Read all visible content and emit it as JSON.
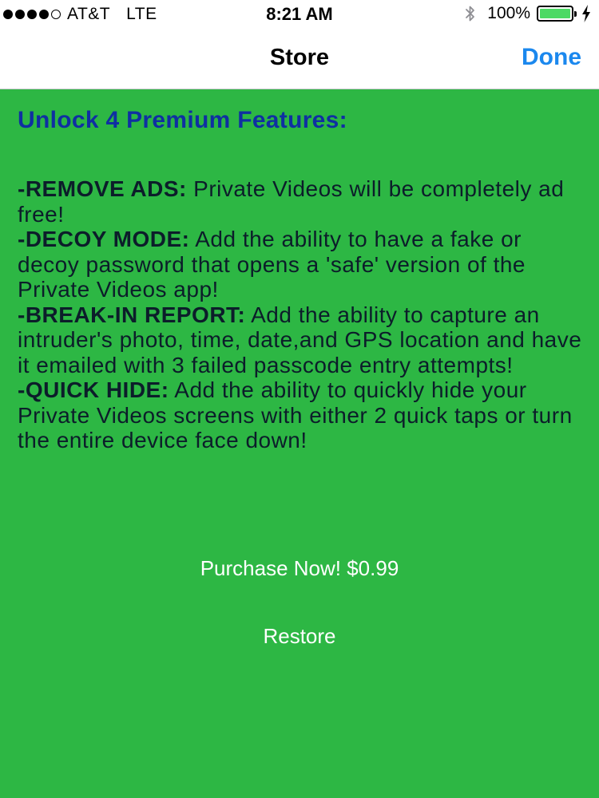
{
  "status_bar": {
    "carrier": "AT&T",
    "network": "LTE",
    "time": "8:21 AM",
    "battery_percent": "100%",
    "battery_level": 1.0,
    "signal_bars_filled": 4,
    "signal_bars_total": 5,
    "icons": [
      "bluetooth-icon",
      "battery-icon",
      "charging-bolt-icon"
    ]
  },
  "nav": {
    "title": "Store",
    "done_label": "Done"
  },
  "content": {
    "heading": "Unlock 4 Premium Features:",
    "features": [
      {
        "title": "-REMOVE ADS:",
        "text": " Private Videos will be completely ad free!"
      },
      {
        "title": "-DECOY MODE:",
        "text": " Add the ability to have a fake or decoy password that opens a 'safe' version of the Private Videos app!"
      },
      {
        "title": "-BREAK-IN REPORT:",
        "text": " Add the ability to capture an intruder's photo, time, date,and GPS location and have it emailed with 3 failed passcode entry attempts!"
      },
      {
        "title": "-QUICK HIDE:",
        "text": " Add the ability to quickly hide your Private Videos screens with either 2 quick taps or turn the entire device face down!"
      }
    ]
  },
  "actions": {
    "purchase_label": "Purchase Now! $0.99",
    "restore_label": "Restore"
  },
  "colors": {
    "background": "#2db744",
    "heading": "#0f2fa2",
    "done": "#1b88ee",
    "battery_fill": "#4cd964"
  }
}
